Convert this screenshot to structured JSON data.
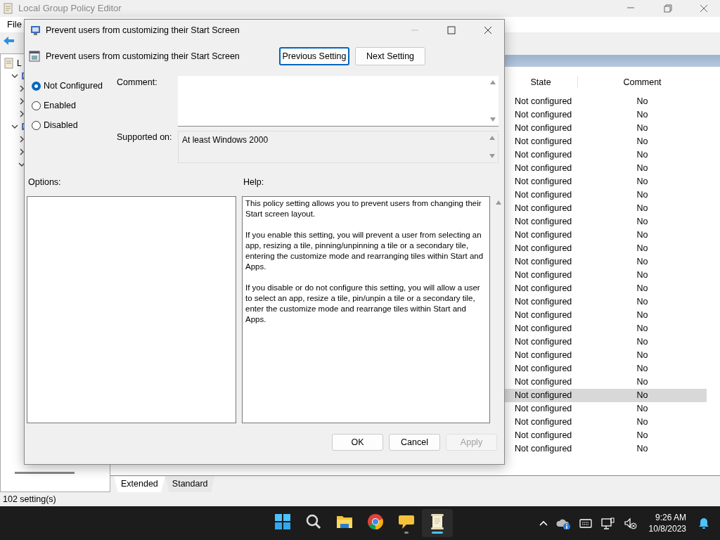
{
  "app_window": {
    "title": "Local Group Policy Editor",
    "menu": [
      "File"
    ],
    "tree": [
      {
        "label": "L",
        "children": [
          {
            "expanded": true,
            "children": [
              {
                "expanded": false
              },
              {
                "expanded": false
              },
              {
                "expanded": false
              }
            ]
          },
          {
            "expanded": true,
            "children": [
              {
                "expanded": false
              },
              {
                "expanded": false
              },
              {
                "expanded": true
              }
            ]
          }
        ]
      }
    ],
    "table": {
      "columns": [
        "State",
        "Comment"
      ],
      "rows": [
        {
          "state": "Not configured",
          "comment": "No",
          "selected": false
        },
        {
          "state": "Not configured",
          "comment": "No",
          "selected": false
        },
        {
          "state": "Not configured",
          "comment": "No",
          "selected": false
        },
        {
          "state": "Not configured",
          "comment": "No",
          "selected": false
        },
        {
          "state": "Not configured",
          "comment": "No",
          "selected": false
        },
        {
          "state": "Not configured",
          "comment": "No",
          "selected": false
        },
        {
          "state": "Not configured",
          "comment": "No",
          "selected": false
        },
        {
          "state": "Not configured",
          "comment": "No",
          "selected": false
        },
        {
          "state": "Not configured",
          "comment": "No",
          "selected": false
        },
        {
          "state": "Not configured",
          "comment": "No",
          "selected": false
        },
        {
          "state": "Not configured",
          "comment": "No",
          "selected": false
        },
        {
          "state": "Not configured",
          "comment": "No",
          "selected": false
        },
        {
          "state": "Not configured",
          "comment": "No",
          "selected": false
        },
        {
          "state": "Not configured",
          "comment": "No",
          "selected": false
        },
        {
          "state": "Not configured",
          "comment": "No",
          "selected": false
        },
        {
          "state": "Not configured",
          "comment": "No",
          "selected": false
        },
        {
          "state": "Not configured",
          "comment": "No",
          "selected": false
        },
        {
          "state": "Not configured",
          "comment": "No",
          "selected": false
        },
        {
          "state": "Not configured",
          "comment": "No",
          "selected": false
        },
        {
          "state": "Not configured",
          "comment": "No",
          "selected": false
        },
        {
          "state": "Not configured",
          "comment": "No",
          "selected": false
        },
        {
          "state": "Not configured",
          "comment": "No",
          "selected": false
        },
        {
          "state": "Not configured",
          "comment": "No",
          "selected": true
        },
        {
          "state": "Not configured",
          "comment": "No",
          "selected": false
        },
        {
          "state": "Not configured",
          "comment": "No",
          "selected": false
        },
        {
          "state": "Not configured",
          "comment": "No",
          "selected": false
        },
        {
          "state": "Not configured",
          "comment": "No",
          "selected": false
        }
      ]
    },
    "tabs": [
      {
        "label": "Extended",
        "selected": true
      },
      {
        "label": "Standard",
        "selected": false
      }
    ],
    "status_bar": "102 setting(s)"
  },
  "dialog": {
    "title": "Prevent users from customizing their Start Screen",
    "setting_title": "Prevent users from customizing their Start Screen",
    "nav_buttons": [
      {
        "label": "Previous Setting",
        "focused": true
      },
      {
        "label": "Next Setting",
        "focused": false
      }
    ],
    "radios": [
      {
        "label": "Not Configured",
        "selected": true
      },
      {
        "label": "Enabled",
        "selected": false
      },
      {
        "label": "Disabled",
        "selected": false
      }
    ],
    "comment_label": "Comment:",
    "supported_label": "Supported on:",
    "supported_value": "At least Windows 2000",
    "options_label": "Options:",
    "help_label": "Help:",
    "help_text": [
      "This policy setting allows you to prevent users from changing their Start screen layout.",
      "If you enable this setting, you will prevent a user from selecting an app, resizing a tile, pinning/unpinning a tile or a secondary tile, entering the customize mode and rearranging tiles within Start and Apps.",
      "If you disable or do not configure this setting, you will allow a user to select an app, resize a tile, pin/unpin a tile or a secondary tile, enter the customize mode and rearrange tiles within Start and Apps."
    ],
    "buttons": [
      {
        "label": "OK",
        "disabled": false
      },
      {
        "label": "Cancel",
        "disabled": false
      },
      {
        "label": "Apply",
        "disabled": true
      }
    ]
  },
  "taskbar": {
    "apps": [
      {
        "kind": "start",
        "running": false,
        "selected": false
      },
      {
        "kind": "search",
        "running": false,
        "selected": false
      },
      {
        "kind": "folder",
        "running": false,
        "selected": false
      },
      {
        "kind": "browser",
        "running": false,
        "selected": false
      },
      {
        "kind": "chat",
        "running": true,
        "selected": false
      },
      {
        "kind": "scroll",
        "running": true,
        "selected": true
      }
    ],
    "tray": [
      {
        "kind": "chevron"
      },
      {
        "kind": "cloud"
      },
      {
        "kind": "keyboard"
      },
      {
        "kind": "network"
      },
      {
        "kind": "speaker"
      }
    ],
    "time": "9:26 AM",
    "date": "10/8/2023"
  }
}
